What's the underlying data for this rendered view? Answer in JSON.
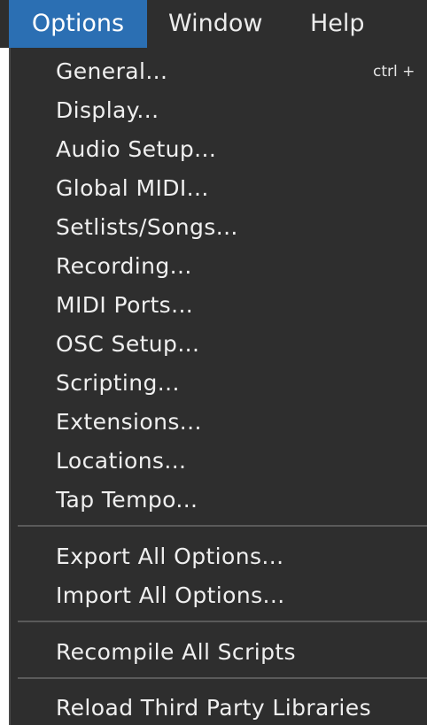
{
  "menubar": {
    "items": [
      {
        "label": "Options",
        "active": true
      },
      {
        "label": "Window",
        "active": false
      },
      {
        "label": "Help",
        "active": false
      }
    ]
  },
  "dropdown": {
    "groups": [
      [
        {
          "label": "General...",
          "shortcut": "ctrl +"
        },
        {
          "label": "Display..."
        },
        {
          "label": "Audio Setup..."
        },
        {
          "label": "Global MIDI..."
        },
        {
          "label": "Setlists/Songs..."
        },
        {
          "label": "Recording..."
        },
        {
          "label": "MIDI Ports..."
        },
        {
          "label": "OSC Setup..."
        },
        {
          "label": "Scripting..."
        },
        {
          "label": "Extensions..."
        },
        {
          "label": "Locations..."
        },
        {
          "label": "Tap Tempo..."
        }
      ],
      [
        {
          "label": "Export All Options..."
        },
        {
          "label": "Import All Options..."
        }
      ],
      [
        {
          "label": "Recompile All Scripts"
        }
      ],
      [
        {
          "label": "Reload Third Party Libraries"
        }
      ]
    ]
  },
  "colors": {
    "menu_background": "#2e2e2e",
    "active_highlight": "#2b6fb3",
    "text": "#efefef",
    "separator": "#5a5a5a"
  }
}
